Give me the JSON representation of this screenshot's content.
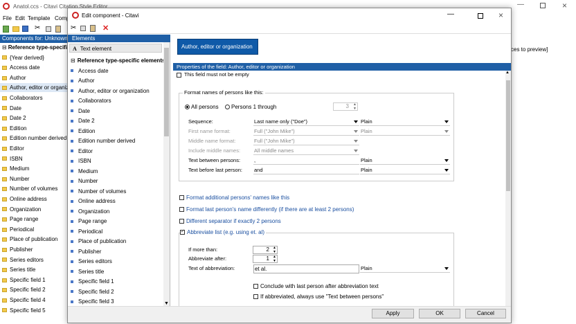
{
  "main_window": {
    "title": "Anatol.ccs - Citavi Citation Style Editor",
    "menu": [
      "File",
      "Edit",
      "Template",
      "Compo"
    ],
    "components_header": "Components for: Unknown",
    "components_items": [
      "Reference type-specific",
      "{Year derived}",
      "Access date",
      "Author",
      "Author, editor or organization",
      "Collaborators",
      "Date",
      "Date 2",
      "Edition",
      "Edition number derived",
      "Editor",
      "ISBN",
      "Medium",
      "Number",
      "Number of volumes",
      "Online address",
      "Organization",
      "Page range",
      "Periodical",
      "Place of publication",
      "Publisher",
      "Series editors",
      "Series title",
      "Specific field 1",
      "Specific field 2",
      "Specific field 4",
      "Specific field 5"
    ],
    "preview_hint": "ces to preview]"
  },
  "dialog": {
    "title": "Edit component - Citavi",
    "elements_header": "Elements",
    "elements": [
      "Text element",
      "Reference type-specific elements",
      "Access date",
      "Author",
      "Author, editor or organization",
      "Collaborators",
      "Date",
      "Date 2",
      "Edition",
      "Edition number derived",
      "Editor",
      "ISBN",
      "Medium",
      "Number",
      "Number of volumes",
      "Online address",
      "Organization",
      "Page range",
      "Periodical",
      "Place of publication",
      "Publisher",
      "Series editors",
      "Series title",
      "Specific field 1",
      "Specific field 2",
      "Specific field 3"
    ],
    "component_chip": "Author, editor or organization",
    "properties_header": "Properties of the field: Author, editor or organization",
    "field_not_empty": "This field must not be empty",
    "format_group": "Format names of persons like this:",
    "radio_all": "All persons",
    "radio_first": "Persons 1 through",
    "persons_count": "3",
    "rows": [
      {
        "label": "Sequence:",
        "value": "Last name only (\"Doe\")",
        "style": "Plain",
        "disabled": false
      },
      {
        "label": "First name format:",
        "value": "Full (\"John Mike\")",
        "style": "Plain",
        "disabled": true
      },
      {
        "label": "Middle name format:",
        "value": "Full (\"John Mike\")",
        "style": "",
        "disabled": true
      },
      {
        "label": "Include middle names:",
        "value": "All middle names",
        "style": "",
        "disabled": true
      },
      {
        "label": "Text between persons:",
        "value": ",",
        "style": "Plain",
        "disabled": false
      },
      {
        "label": "Text before last person:",
        "value": "and",
        "style": "Plain",
        "disabled": false
      }
    ],
    "opt_additional": "Format additional persons' names like this",
    "opt_last": "Format last person's name differently (if there are at least 2 persons)",
    "opt_separator": "Different separator if exactly 2 persons",
    "opt_abbreviate": "Abbreviate list (e.g. using et. al)",
    "if_more_label": "If more than:",
    "if_more_value": "2",
    "abbrev_after_label": "Abbreviate after:",
    "abbrev_after_value": "1",
    "abbrev_text_label": "Text of abbreviation:",
    "abbrev_text_value": "et al.",
    "abbrev_style": "Plain",
    "conclude": "Conclude with last person after abbreviation text",
    "if_abbrev": "If abbreviated, always use \"Text between persons\"",
    "apply": "Apply",
    "ok": "OK",
    "cancel": "Cancel"
  },
  "colors": {
    "accent": "#0a5eab",
    "header_blue": "#1f5fa6",
    "chip_bg": "#0f5aa8"
  }
}
